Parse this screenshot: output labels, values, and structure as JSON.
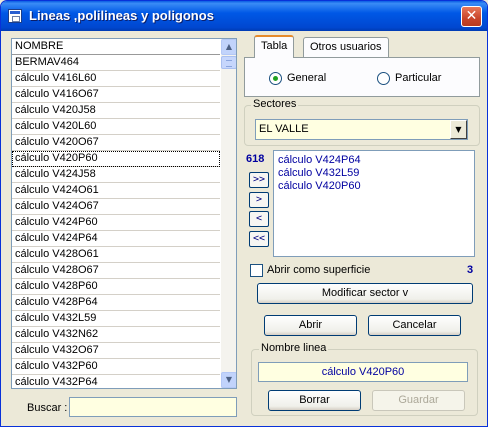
{
  "window": {
    "title": "Lineas ,polilineas y poligonos",
    "close_glyph": "✕"
  },
  "list": {
    "header": "NOMBRE",
    "items": [
      "BERMAV464",
      "cálculo V416L60",
      "cálculo V416O67",
      "cálculo V420J58",
      "cálculo V420L60",
      "cálculo V420O67",
      "cálculo V420P60",
      "cálculo V424J58",
      "cálculo V424O61",
      "cálculo V424O67",
      "cálculo V424P60",
      "cálculo V424P64",
      "cálculo V428O61",
      "cálculo V428O67",
      "cálculo V428P60",
      "cálculo V428P64",
      "cálculo V432L59",
      "cálculo V432N62",
      "cálculo V432O67",
      "cálculo V432P60",
      "cálculo V432P64"
    ],
    "focused_item": "cálculo V420P60",
    "scroll_up_glyph": "▲",
    "scroll_down_glyph": "▼"
  },
  "buscar": {
    "label": "Buscar :",
    "value": ""
  },
  "tabs": {
    "items": [
      "Tabla",
      "Otros usuarios"
    ],
    "active": "Tabla"
  },
  "radios": {
    "general_label": "General",
    "particular_label": "Particular",
    "selected": "General"
  },
  "sectores": {
    "legend": "Sectores",
    "selected": "EL VALLE",
    "dropdown_glyph": "▼"
  },
  "selection": {
    "count": "618",
    "items": [
      "cálculo V424P64",
      "cálculo V432L59",
      "cálculo V420P60"
    ]
  },
  "arrow_buttons": {
    "add_all": ">>",
    "add_one": ">",
    "remove_one": "<",
    "remove_all": "<<"
  },
  "surface": {
    "checkbox_label": "Abrir como superficie",
    "checked": false,
    "count": "3"
  },
  "buttons": {
    "modificar": "Modificar sector    v",
    "abrir": "Abrir",
    "cancelar": "Cancelar",
    "borrar": "Borrar",
    "guardar": "Guardar"
  },
  "nombre_linea": {
    "legend": "Nombre linea",
    "value": "cálculo V420P60"
  },
  "colors": {
    "title_bar": "#0058e6",
    "window_bg": "#ece9d8",
    "input_bg": "#ffffe1",
    "accent_text": "#0000a0"
  }
}
